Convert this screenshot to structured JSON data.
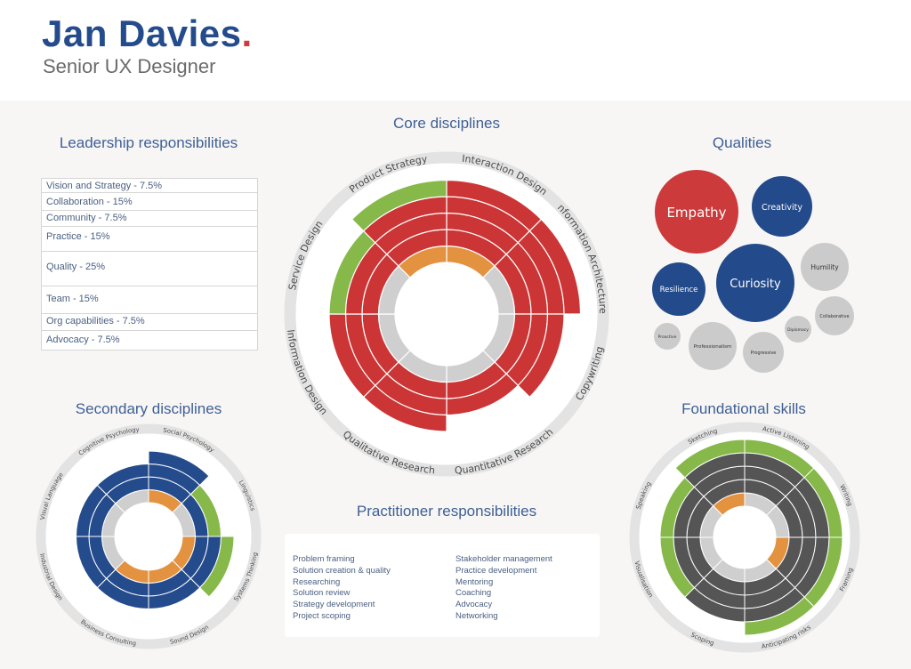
{
  "header": {
    "name": "Jan Davies",
    "name_dot": ".",
    "role": "Senior UX Designer"
  },
  "colors": {
    "brand_blue": "#244b8c",
    "accent_red": "#d03a3b",
    "core_red": "#cc3535",
    "secondary_blue": "#244b8c",
    "foundation_dark": "#555555",
    "green": "#86b94a",
    "orange": "#e39240",
    "base_gray": "#cfcfcf",
    "track_gray": "#e3e3e3"
  },
  "sections": {
    "leadership": "Leadership responsibilities",
    "core": "Core disciplines",
    "qualities": "Qualities",
    "secondary": "Secondary disciplines",
    "practitioner": "Practitioner responsibilities",
    "foundational": "Foundational skills"
  },
  "leadership": {
    "items": [
      {
        "label": "Vision and Strategy - 7.5%",
        "weight": 7.5
      },
      {
        "label": "Collaboration - 15%",
        "weight": 15
      },
      {
        "label": "Community - 7.5%",
        "weight": 7.5
      },
      {
        "label": "Practice - 15%",
        "weight": 15
      },
      {
        "label": "Quality - 25%",
        "weight": 25
      },
      {
        "label": "Team - 15%",
        "weight": 15
      },
      {
        "label": "Org capabilities - 7.5%",
        "weight": 7.5
      },
      {
        "label": "Advocacy - 7.5%",
        "weight": 7.5
      }
    ]
  },
  "practitioner": {
    "left": [
      "Problem framing",
      "Solution creation & quality",
      "Researching",
      "Solution review",
      "Strategy development",
      "Project scoping"
    ],
    "right": [
      "Stakeholder management",
      "Practice development",
      "Mentoring",
      "Coaching",
      "Advocacy",
      "Networking"
    ]
  },
  "qualities": {
    "items": [
      {
        "label": "Empathy",
        "tier": "primary"
      },
      {
        "label": "Creativity",
        "tier": "secondary"
      },
      {
        "label": "Curiosity",
        "tier": "secondary"
      },
      {
        "label": "Resilience",
        "tier": "secondary"
      },
      {
        "label": "Humility",
        "tier": "tertiary"
      },
      {
        "label": "Collaborative",
        "tier": "tertiary"
      },
      {
        "label": "Diplomacy",
        "tier": "tertiary"
      },
      {
        "label": "Progressive",
        "tier": "tertiary"
      },
      {
        "label": "Professionalism",
        "tier": "tertiary"
      },
      {
        "label": "Proactive",
        "tier": "tertiary"
      }
    ]
  },
  "chart_data": [
    {
      "type": "polar-bar",
      "title": "Core disciplines",
      "max_level": 5,
      "legend_codes": {
        "g": "base",
        "o": "highlight",
        "p": "primary",
        "a": "stretch"
      },
      "categories": [
        "Interaction Design",
        "Information Architecture",
        "Copywriting",
        "Quantitative Research",
        "Qualitative Research",
        "Information Design",
        "Service Design",
        "Product Strategy"
      ],
      "rings": [
        [
          "o",
          "p",
          "p",
          "p",
          "p"
        ],
        [
          "g",
          "p",
          "p",
          "p",
          "p"
        ],
        [
          "g",
          "p",
          "p",
          "p"
        ],
        [
          "g",
          "p",
          "p"
        ],
        [
          "g",
          "p",
          "p",
          "p"
        ],
        [
          "g",
          "p",
          "p",
          "p"
        ],
        [
          "g",
          "p",
          "p",
          "a"
        ],
        [
          "o",
          "p",
          "p",
          "p",
          "a"
        ]
      ]
    },
    {
      "type": "polar-bar",
      "title": "Secondary disciplines",
      "max_level": 4,
      "legend_codes": {
        "g": "base",
        "o": "highlight",
        "p": "primary",
        "a": "stretch"
      },
      "categories": [
        "Social Psychology",
        "Linguistics",
        "Systems Thinking",
        "Sound Design",
        "Business Consulting",
        "Industrial Design",
        "Visual Language",
        "Cognitive Psychology"
      ],
      "rings": [
        [
          "o",
          "p",
          "p",
          "p"
        ],
        [
          "g",
          "p",
          "a"
        ],
        [
          "o",
          "p",
          "p",
          "a"
        ],
        [
          "o",
          "p",
          "p"
        ],
        [
          "o",
          "p",
          "p"
        ],
        [
          "g",
          "p",
          "p"
        ],
        [
          "g",
          "p",
          "p"
        ],
        [
          "g",
          "p",
          "p"
        ]
      ]
    },
    {
      "type": "polar-bar",
      "title": "Foundational skills",
      "max_level": 5,
      "legend_codes": {
        "g": "base",
        "o": "highlight",
        "p": "primary",
        "a": "stretch"
      },
      "categories": [
        "Active Listening",
        "Writing",
        "Framing",
        "Anticipating risks",
        "Scoping",
        "Visualisation",
        "Speaking",
        "Sketching"
      ],
      "rings": [
        [
          "g",
          "p",
          "p",
          "p",
          "a"
        ],
        [
          "g",
          "p",
          "p",
          "p",
          "a"
        ],
        [
          "o",
          "p",
          "p",
          "p",
          "a"
        ],
        [
          "g",
          "p",
          "p",
          "p",
          "a"
        ],
        [
          "g",
          "p",
          "p",
          "p"
        ],
        [
          "g",
          "p",
          "p",
          "a"
        ],
        [
          "g",
          "p",
          "p",
          "a"
        ],
        [
          "o",
          "p",
          "p",
          "p",
          "a"
        ]
      ]
    }
  ]
}
